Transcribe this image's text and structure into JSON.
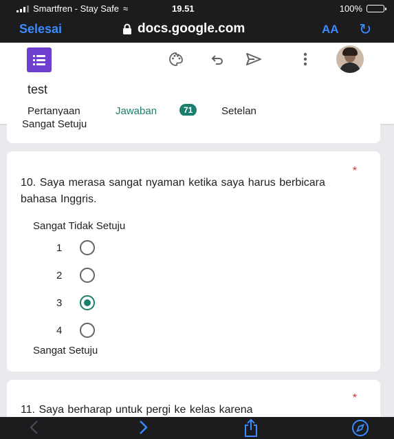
{
  "status_bar": {
    "carrier": "Smartfren - Stay Safe",
    "time": "19.51",
    "battery": "100%"
  },
  "browser": {
    "done_label": "Selesai",
    "domain": "docs.google.com",
    "text_size_label": "AA"
  },
  "toolbar_icons": [
    "palette-icon",
    "undo-icon",
    "send-icon",
    "more-icon"
  ],
  "form": {
    "title": "test",
    "tabs": {
      "questions": "Pertanyaan",
      "responses": "Jawaban",
      "responses_count": "71",
      "settings": "Setelan"
    }
  },
  "prev_card": {
    "text": "Sangat Setuju"
  },
  "question10": {
    "required_mark": "*",
    "text": "10. Saya    merasa sangat nyaman ketika saya harus berbicara bahasa Inggris.",
    "low_label": "Sangat Tidak Setuju",
    "high_label": "Sangat Setuju",
    "options": [
      "1",
      "2",
      "3",
      "4"
    ],
    "selected": "3"
  },
  "question11": {
    "required_mark": "*",
    "text": "11. Saya berharap untuk pergi ke kelas karena"
  },
  "colors": {
    "accent": "#1a7f6e",
    "forms_purple": "#6e3fcf",
    "ios_blue": "#3a8bff",
    "required": "#d93025"
  }
}
